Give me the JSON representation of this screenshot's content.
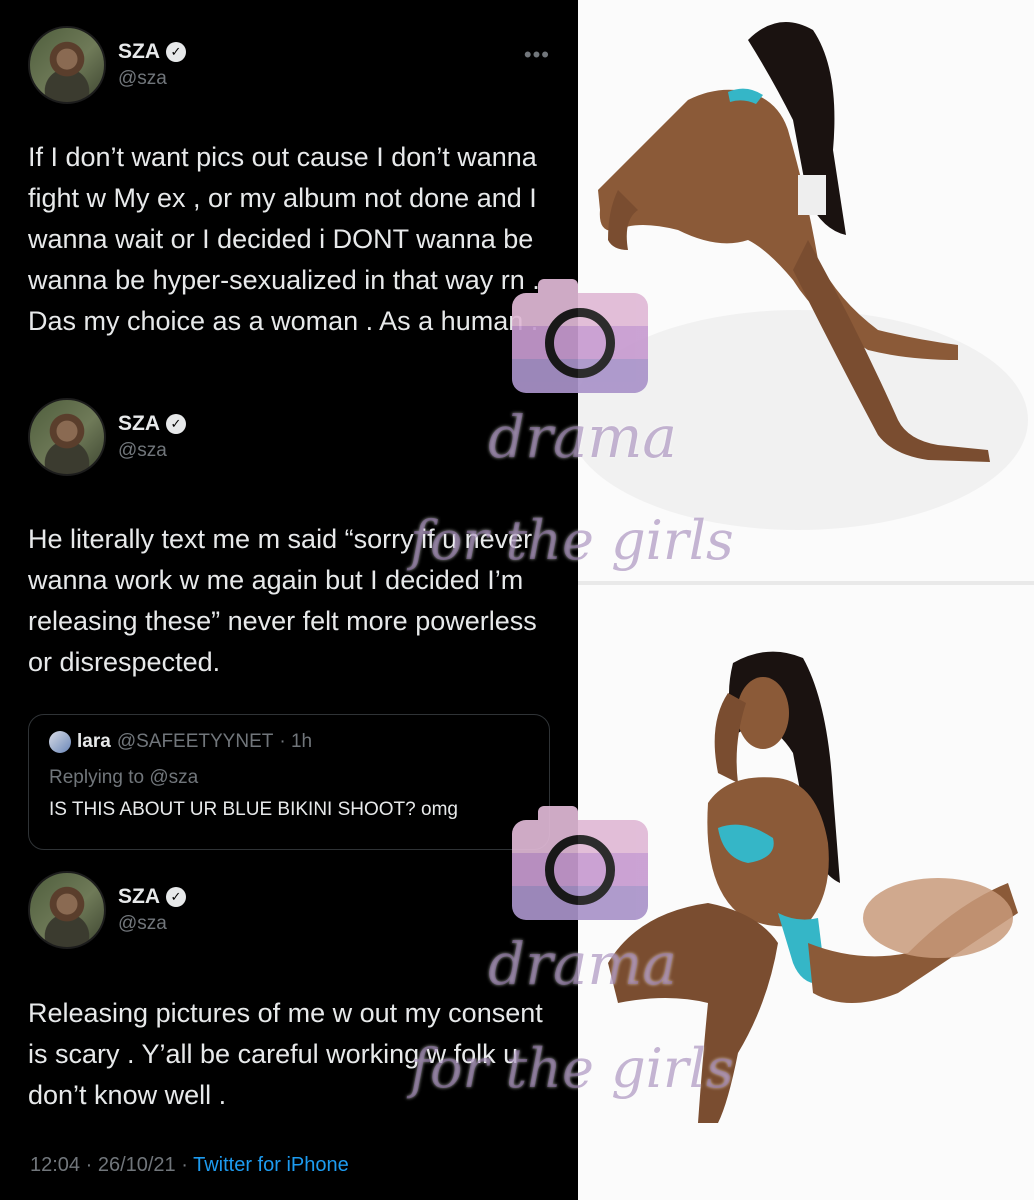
{
  "tweets": [
    {
      "name": "SZA",
      "handle": "@sza",
      "text": "If I don’t want pics out cause I don’t wanna fight w My ex , or my album not done and I wanna wait or I decided i DONT wanna be wanna be hyper-sexualized in that way rn . Das my choice as a woman . As a human ."
    },
    {
      "name": "SZA",
      "handle": "@sza",
      "text": "He literally text me m said “sorry if u never wanna work w me again but I decided I’m releasing these” never felt more powerless or disrespected."
    },
    {
      "name": "SZA",
      "handle": "@sza",
      "text": "Releasing pictures of me w out my consent is scary . Y’all be careful working w folk u don’t know well ."
    }
  ],
  "quote": {
    "name": "lara",
    "handle": "@SAFEETYYNET",
    "time": "· 1h",
    "replying_to": "Replying to @sza",
    "text": "IS THIS ABOUT UR BLUE BIKINI SHOOT? omg"
  },
  "footer": {
    "time": "12:04 · 26/10/21 · ",
    "source": "Twitter for iPhone"
  },
  "watermark": {
    "line1": "drama",
    "line2": "for the girls"
  },
  "icons": {
    "verified": "verified-icon",
    "more": "more-icon",
    "watermark": "camera-icon"
  },
  "colors": {
    "background": "#000000",
    "text": "#e7e9ea",
    "muted": "#71767b",
    "link": "#1d9bf0",
    "border": "#2f3336",
    "watermark": "#9678af"
  }
}
